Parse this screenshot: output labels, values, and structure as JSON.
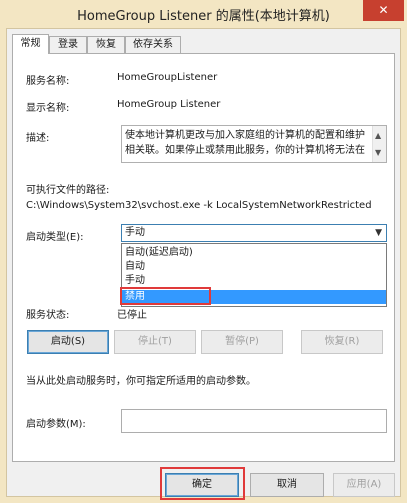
{
  "window": {
    "title": "HomeGroup Listener 的属性(本地计算机)",
    "close_glyph": "✕"
  },
  "tabs": [
    {
      "label": "常规"
    },
    {
      "label": "登录"
    },
    {
      "label": "恢复"
    },
    {
      "label": "依存关系"
    }
  ],
  "general": {
    "service_name_label": "服务名称:",
    "service_name_value": "HomeGroupListener",
    "display_name_label": "显示名称:",
    "display_name_value": "HomeGroup Listener",
    "description_label": "描述:",
    "description_text": "使本地计算机更改与加入家庭组的计算机的配置和维护相关联。如果停止或禁用此服务，你的计算机将无法在",
    "exe_path_label": "可执行文件的路径:",
    "exe_path_value": "C:\\Windows\\System32\\svchost.exe -k LocalSystemNetworkRestricted",
    "startup_type_label": "启动类型(E):",
    "startup_type_value": "手动",
    "startup_options": [
      "自动(延迟启动)",
      "自动",
      "手动",
      "禁用"
    ],
    "startup_highlighted": "禁用",
    "service_status_label": "服务状态:",
    "service_status_value": "已停止",
    "start_button": "启动(S)",
    "stop_button": "停止(T)",
    "pause_button": "暂停(P)",
    "resume_button": "恢复(R)",
    "hint_text": "当从此处启动服务时，你可指定所适用的启动参数。",
    "start_params_label": "启动参数(M):",
    "start_params_value": ""
  },
  "footer": {
    "ok": "确定",
    "cancel": "取消",
    "apply": "应用(A)"
  },
  "colors": {
    "titlebar": "#f3e6c3",
    "close_button": "#c7402f",
    "selection": "#3399ff",
    "highlight_box": "#e03a3a"
  }
}
